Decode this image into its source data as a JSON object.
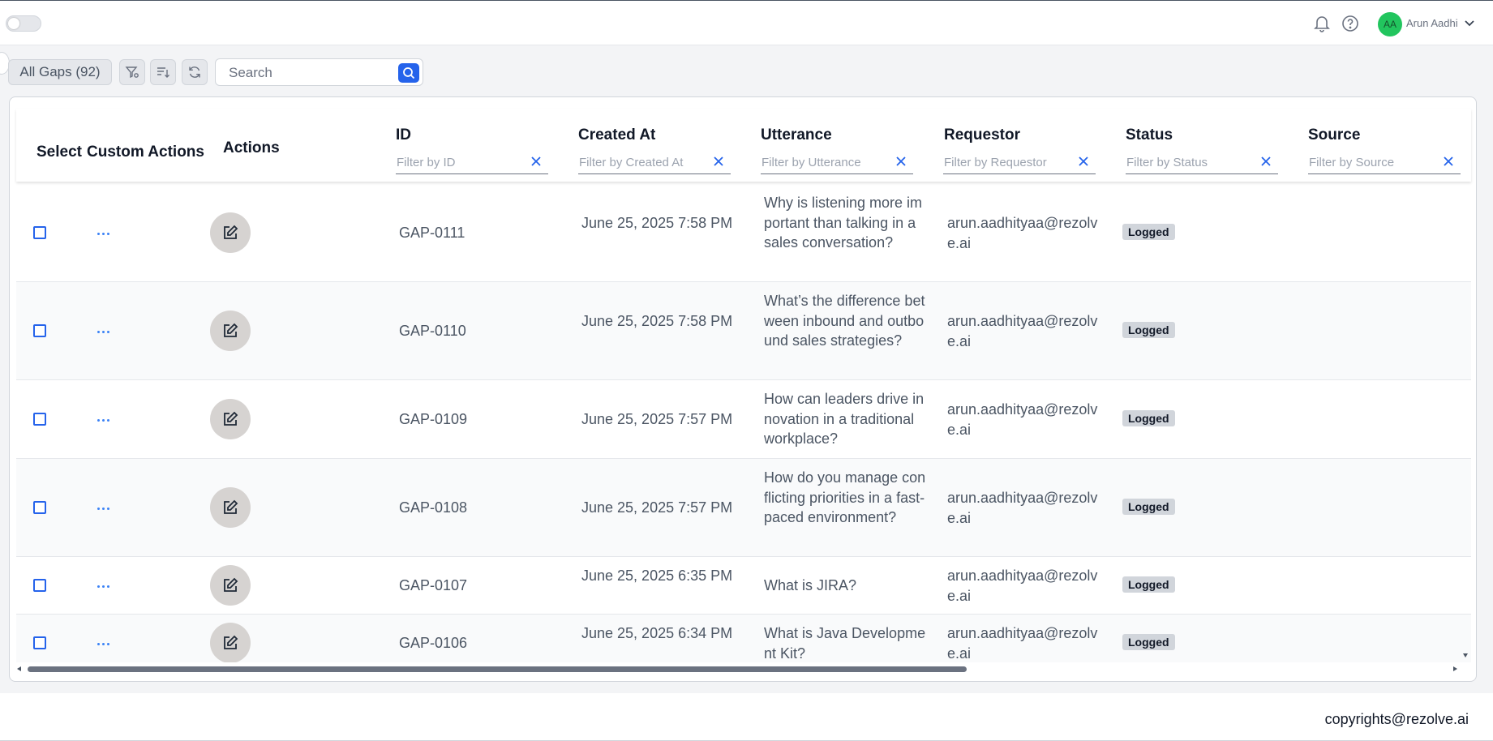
{
  "header": {
    "theme_toggle": {
      "on": false
    },
    "user": {
      "initials": "AA",
      "name": "Arun Aadhi"
    },
    "icons": [
      "bell-icon",
      "help-icon",
      "chevron-down-icon"
    ]
  },
  "toolbar": {
    "view_label": "All Gaps (92)",
    "search_placeholder": "Search",
    "icons": [
      "filter-icon",
      "sort-icon",
      "refresh-icon",
      "search-icon"
    ]
  },
  "table": {
    "headers": {
      "select": "Select",
      "custom_actions": "Custom Actions",
      "actions": "Actions",
      "id": "ID",
      "created_at": "Created At",
      "utterance": "Utterance",
      "requestor": "Requestor",
      "status": "Status",
      "source": "Source"
    },
    "filters": {
      "id": "Filter by ID",
      "created_at": "Filter by Created At",
      "utterance": "Filter by Utterance",
      "requestor": "Filter by Requestor",
      "status": "Filter by Status",
      "source": "Filter by Source"
    },
    "rows": [
      {
        "id": "GAP-0111",
        "created_at": "June 25, 2025 7:58 PM",
        "utterance": "Why is listening more important than talking in a sales conversation?",
        "requestor": "arun.aadhityaa@rezolve.ai",
        "status": "Logged",
        "source": ""
      },
      {
        "id": "GAP-0110",
        "created_at": "June 25, 2025 7:58 PM",
        "utterance": "What’s the difference between inbound and outbound sales strategies?",
        "requestor": "arun.aadhityaa@rezolve.ai",
        "status": "Logged",
        "source": ""
      },
      {
        "id": "GAP-0109",
        "created_at": "June 25, 2025 7:57 PM",
        "utterance": "How can leaders drive innovation in a traditional workplace?",
        "requestor": "arun.aadhityaa@rezolve.ai",
        "status": "Logged",
        "source": ""
      },
      {
        "id": "GAP-0108",
        "created_at": "June 25, 2025 7:57 PM",
        "utterance": "How do you manage conflicting priorities in a fast-paced environment?",
        "requestor": "arun.aadhityaa@rezolve.ai",
        "status": "Logged",
        "source": ""
      },
      {
        "id": "GAP-0107",
        "created_at": "June 25, 2025 6:35 PM",
        "utterance": "What is JIRA?",
        "requestor": "arun.aadhityaa@rezolve.ai",
        "status": "Logged",
        "source": ""
      },
      {
        "id": "GAP-0106",
        "created_at": "June 25, 2025 6:34 PM",
        "utterance": "What is Java Development Kit?",
        "requestor": "arun.aadhityaa@rezolve.ai",
        "status": "Logged",
        "source": ""
      }
    ]
  },
  "footer": {
    "copyright": "copyrights@rezolve.ai"
  }
}
